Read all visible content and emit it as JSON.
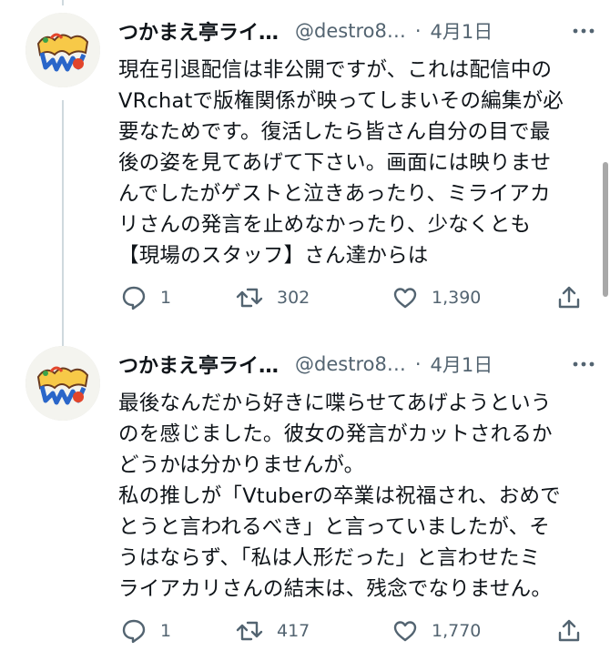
{
  "tweets": [
    {
      "display_name": "つかまえ亭ライ…",
      "handle": "@destro8…",
      "separator": "·",
      "time": "4月1日",
      "lines": [
        "現在引退配信は非公開ですが、これは配信中の",
        "VRchatで版権関係が映ってしまいその編集が必",
        "要なためです。復活したら皆さん自分の目で最",
        "後の姿を見てあげて下さい。画面には映りませ",
        "んでしたがゲストと泣きあったり、ミライアカ",
        "リさんの発言を止めなかったり、少なくとも",
        "【現場のスタッフ】さん達からは"
      ],
      "replies": "1",
      "retweets": "302",
      "likes": "1,390"
    },
    {
      "display_name": "つかまえ亭ライ…",
      "handle": "@destro8…",
      "separator": "·",
      "time": "4月1日",
      "lines": [
        "最後なんだから好きに喋らせてあげようという",
        "のを感じました。彼女の発言がカットされるか",
        "どうかは分かりませんが。",
        "私の推しが「Vtuberの卒業は祝福され、おめで",
        "とうと言われるべき」と言っていましたが、そ",
        "うはならず、「私は人形だった」と言わせたミ",
        "ライアカリさんの結末は、残念でなりません。"
      ],
      "replies": "1",
      "retweets": "417",
      "likes": "1,770"
    }
  ],
  "colors": {
    "text": "#0f1419",
    "secondary": "#536471",
    "thread_line": "#cfd9de"
  },
  "icons": {
    "reply": "reply-icon",
    "retweet": "retweet-icon",
    "like": "like-icon",
    "share": "share-icon",
    "more": "more-icon"
  }
}
